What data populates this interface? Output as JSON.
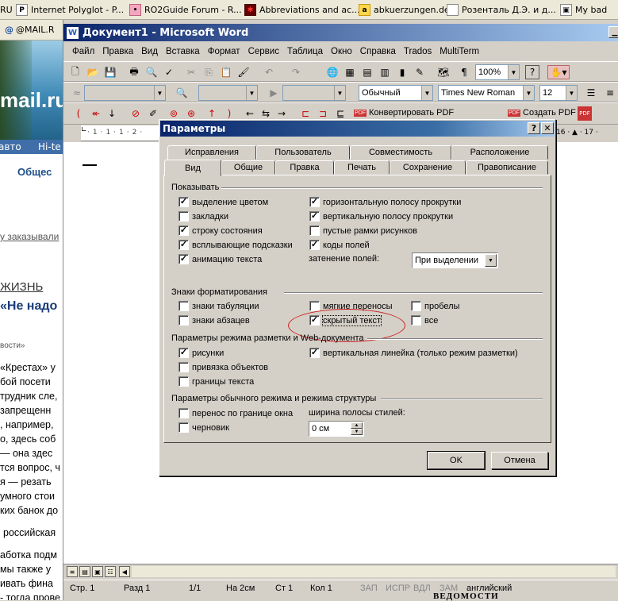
{
  "bookmarks": [
    {
      "label": "RU",
      "icon": "ru-site-icon"
    },
    {
      "label": "Internet Polyglot - P...",
      "icon": "P"
    },
    {
      "label": "RO2Guide Forum - R...",
      "icon": "pig"
    },
    {
      "label": "Abbreviations and ac...",
      "icon": "spark"
    },
    {
      "label": "abkuerzungen.de",
      "icon": "a"
    },
    {
      "label": "Розенталь Д.Э. и д...",
      "icon": "page"
    },
    {
      "label": "My bad",
      "icon": "box"
    }
  ],
  "browser_tab": {
    "label": "@MAIL.R"
  },
  "webpage": {
    "logo": "mail.ru",
    "nav": [
      "авто",
      "Hi-te"
    ],
    "section_tab": "Общес",
    "lines": [
      "у заказывали",
      "ЖИЗНЬ",
      "«Не надо",
      "вости»",
      "«Крестах» у",
      "бой посети",
      "трудник сле,",
      "запрещенн",
      ", например, ",
      "о, здесь соб",
      "— она здес",
      "тся вопрос, ч",
      "я — резать",
      "умного стои",
      "ких банок до",
      "российская",
      "аботка подм",
      "мы также у",
      "ивать фина",
      "- тогда прове"
    ]
  },
  "word": {
    "title": "Документ1 - Microsoft Word",
    "menu": [
      "Файл",
      "Правка",
      "Вид",
      "Вставка",
      "Формат",
      "Сервис",
      "Таблица",
      "Окно",
      "Справка",
      "Trados",
      "MultiTerm"
    ],
    "zoom": "100%",
    "style": "Обычный",
    "font": "Times New Roman",
    "size": "12",
    "pdf_convert": "Конвертировать PDF",
    "pdf_create": "Создать PDF",
    "ruler_right": "16 · ▲ · 17 ·",
    "status": {
      "page": "Стр. 1",
      "section": "Разд 1",
      "pages": "1/1",
      "at": "На 2см",
      "line": "Ст 1",
      "col": "Кол 1",
      "rec": "ЗАП",
      "trk": "ИСПР",
      "ext": "ВДЛ",
      "ovr": "ЗАМ",
      "lang": "английский"
    },
    "bottom_text": "ВЕДОМОСТИ"
  },
  "dialog": {
    "title": "Параметры",
    "help": "?",
    "close": "✕",
    "tabs_row1": [
      "Исправления",
      "Пользователь",
      "Совместимость",
      "Расположение"
    ],
    "tabs_row2": [
      "Вид",
      "Общие",
      "Правка",
      "Печать",
      "Сохранение",
      "Правописание"
    ],
    "show": {
      "title": "Показывать",
      "left": [
        {
          "label": "выделение цветом",
          "checked": true
        },
        {
          "label": "закладки",
          "checked": false
        },
        {
          "label": "строку состояния",
          "checked": true
        },
        {
          "label": "всплывающие подсказки",
          "checked": true
        },
        {
          "label": "анимацию текста",
          "checked": true
        }
      ],
      "right": [
        {
          "label": "горизонтальную полосу прокрутки",
          "checked": true
        },
        {
          "label": "вертикальную полосу прокрутки",
          "checked": true
        },
        {
          "label": "пустые рамки рисунков",
          "checked": false
        },
        {
          "label": "коды полей",
          "checked": true
        }
      ],
      "shading_label": "затенение полей:",
      "shading_value": "При выделении"
    },
    "formatting": {
      "title": "Знаки форматирования",
      "items": [
        {
          "label": "знаки табуляции",
          "checked": false
        },
        {
          "label": "мягкие переносы",
          "checked": false
        },
        {
          "label": "пробелы",
          "checked": false
        },
        {
          "label": "знаки абзацев",
          "checked": false
        },
        {
          "label": "скрытый текст",
          "checked": true
        },
        {
          "label": "все",
          "checked": false
        }
      ]
    },
    "layout": {
      "title": "Параметры режима разметки и Web-документа",
      "items": [
        {
          "label": "рисунки",
          "checked": true
        },
        {
          "label": "привязка объектов",
          "checked": false
        },
        {
          "label": "границы текста",
          "checked": false
        },
        {
          "label": "вертикальная линейка (только режим разметки)",
          "checked": true
        }
      ]
    },
    "normal": {
      "title": "Параметры обычного режима и режима структуры",
      "items": [
        {
          "label": "перенос по границе окна",
          "checked": false
        },
        {
          "label": "черновик",
          "checked": false
        }
      ],
      "width_label": "ширина полосы стилей:",
      "width_value": "0 см"
    },
    "ok": "OK",
    "cancel": "Отмена"
  }
}
